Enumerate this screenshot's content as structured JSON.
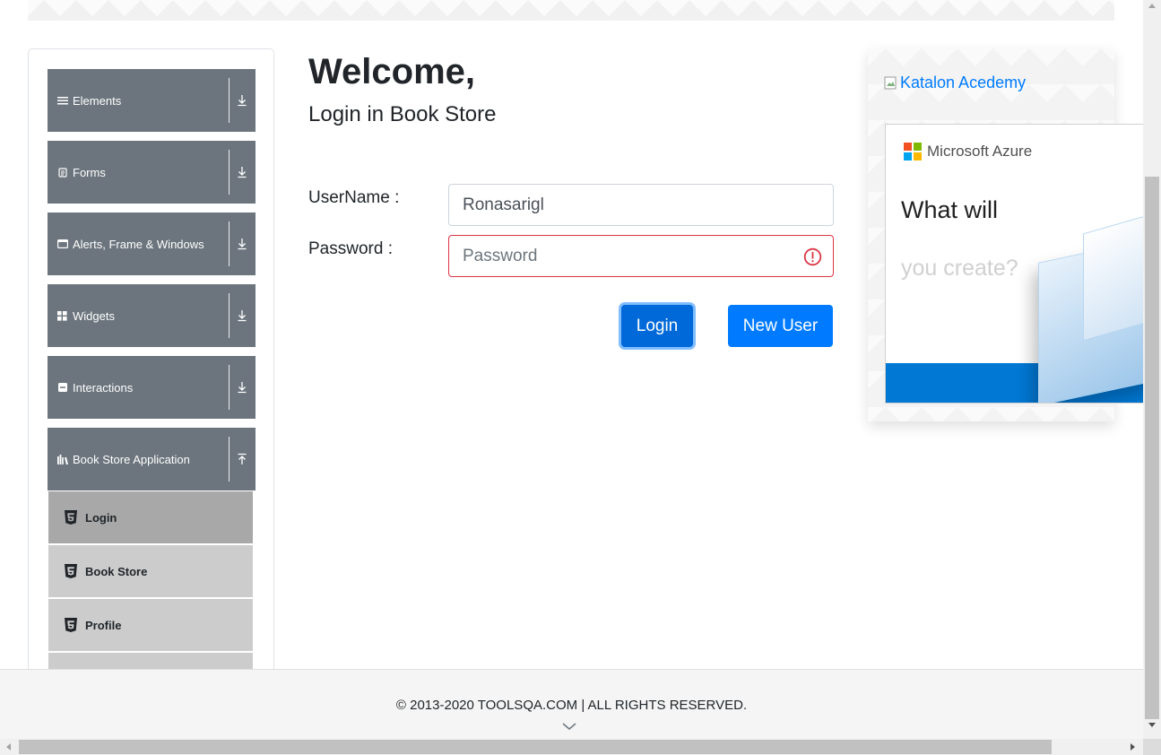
{
  "sidebar": {
    "groups": [
      {
        "label": "Elements",
        "icon": "hamburger-icon",
        "arrow": "download-arrow-icon"
      },
      {
        "label": "Forms",
        "icon": "document-icon",
        "arrow": "download-arrow-icon"
      },
      {
        "label": "Alerts, Frame & Windows",
        "icon": "window-icon",
        "arrow": "download-arrow-icon"
      },
      {
        "label": "Widgets",
        "icon": "grid-icon",
        "arrow": "download-arrow-icon"
      },
      {
        "label": "Interactions",
        "icon": "interaction-icon",
        "arrow": "download-arrow-icon"
      },
      {
        "label": "Book Store Application",
        "icon": "books-icon",
        "arrow": "upload-arrow-icon"
      }
    ],
    "sub_items": [
      {
        "label": "Login",
        "active": true,
        "icon": "html5-icon"
      },
      {
        "label": "Book Store",
        "active": false,
        "icon": "html5-icon"
      },
      {
        "label": "Profile",
        "active": false,
        "icon": "html5-icon"
      }
    ]
  },
  "main": {
    "title": "Welcome,",
    "subtitle": "Login in Book Store",
    "username_label": "UserName :",
    "username_value": "Ronasarigl",
    "password_label": "Password :",
    "password_placeholder": "Password",
    "login_button": "Login",
    "new_user_button": "New User"
  },
  "ad": {
    "broken_image_alt": "Katalon Acedemy",
    "azure_brand": "Microsoft Azure",
    "azure_line1": "What will",
    "azure_line2": "you create?"
  },
  "footer": {
    "text": "© 2013-2020 TOOLSQA.COM | ALL RIGHTS RESERVED."
  },
  "colors": {
    "sidebar_group_bg": "#6c757d",
    "primary": "#007bff",
    "invalid": "#dc3545",
    "sub_active": "#a8a8a8",
    "sub_inactive": "#cccccc",
    "azure_blue": "#0078d4"
  }
}
